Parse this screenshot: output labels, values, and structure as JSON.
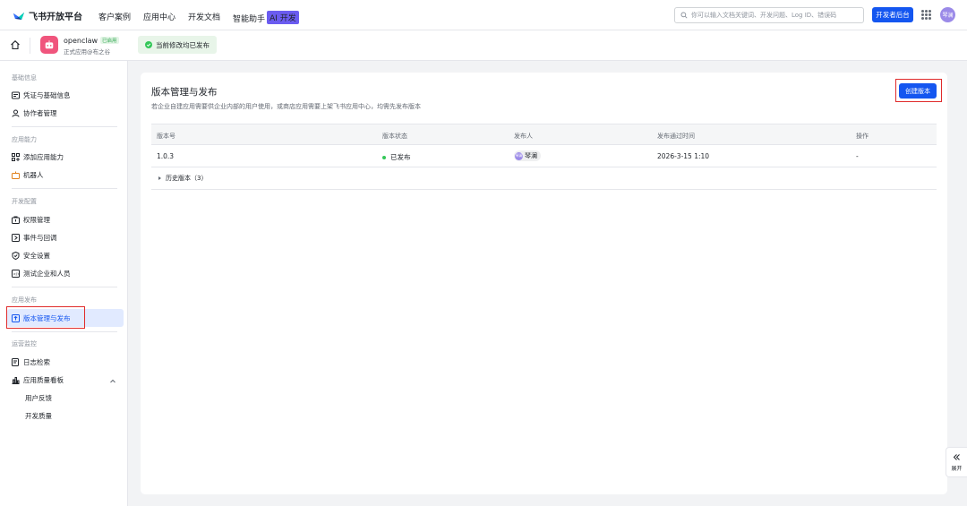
{
  "topbar": {
    "brand": "飞书开放平台",
    "nav": [
      "客户案例",
      "应用中心",
      "开发文档",
      "智能助手"
    ],
    "ai_badge": "AI 开发",
    "search_placeholder": "你可以输入文档关键词、开发问题、Log ID、错误码",
    "dev_console_label": "开发者后台",
    "avatar_text": "琴澜"
  },
  "appbar": {
    "app_name": "openclaw",
    "app_tag": "已启用",
    "app_subtitle": "正式应用@布之谷",
    "status_text": "当前修改均已发布"
  },
  "sidebar": {
    "sections": [
      {
        "title": "基础信息",
        "items": [
          "凭证与基础信息",
          "协作者管理"
        ]
      },
      {
        "title": "应用能力",
        "items": [
          "添加应用能力",
          "机器人"
        ]
      },
      {
        "title": "开发配置",
        "items": [
          "权限管理",
          "事件与回调",
          "安全设置",
          "测试企业和人员"
        ]
      },
      {
        "title": "应用发布",
        "items": [
          "版本管理与发布"
        ]
      },
      {
        "title": "运营监控",
        "items": [
          "日志检索",
          "应用质量看板"
        ]
      }
    ],
    "sub_items": [
      "用户反馈",
      "开发质量"
    ]
  },
  "main": {
    "title": "版本管理与发布",
    "description": "若企业自建应用需要供企业内部的用户使用，或商店应用需要上架飞书应用中心，均需先发布版本",
    "create_button": "创建版本",
    "columns": [
      "版本号",
      "版本状态",
      "发布人",
      "发布通过时间",
      "操作"
    ],
    "rows": [
      {
        "version": "1.0.3",
        "status": "已发布",
        "publisher": "琴澜",
        "publisher_avatar": "琴澜",
        "time": "2026-3-15 1:10",
        "action": "-"
      }
    ],
    "history_label": "历史版本（3）"
  },
  "expand_label": "展开",
  "colors": {
    "primary": "#1456f0",
    "success": "#34c759",
    "highlight_box": "#e02b2b",
    "active_bg": "#e1eaff"
  }
}
